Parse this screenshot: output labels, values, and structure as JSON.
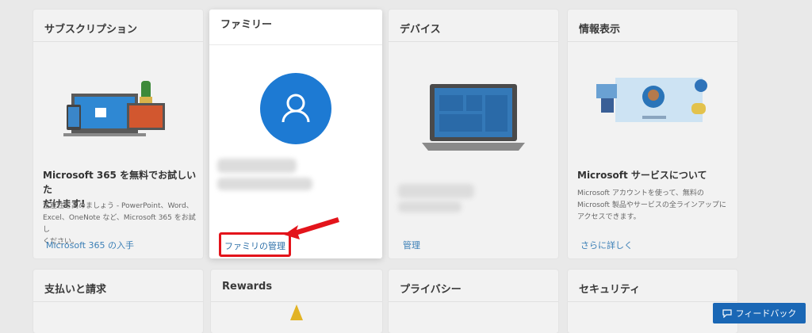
{
  "cards": {
    "subscription": {
      "title": "サブスクリプション",
      "headline_line1": "Microsoft 365 を無料でお試しいた",
      "headline_line2": "だけます!",
      "desc_line1": "生産性を高めましょう - PowerPoint、Word、",
      "desc_line2": "Excel、OneNote など、Microsoft 365 をお試し",
      "desc_line3": "ください。",
      "link": "Microsoft 365 の入手"
    },
    "family": {
      "title": "ファミリー",
      "link": "ファミリの管理"
    },
    "devices": {
      "title": "デバイス",
      "link": "管理"
    },
    "info": {
      "title": "情報表示",
      "headline": "Microsoft サービスについて",
      "desc_line1": "Microsoft アカウントを使って、無料の",
      "desc_line2": "Microsoft 製品やサービスの全ラインアップに",
      "desc_line3": "アクセスできます。",
      "link": "さらに詳しく"
    },
    "payment": {
      "title": "支払いと請求"
    },
    "rewards": {
      "title": "Rewards"
    },
    "privacy": {
      "title": "プライバシー"
    },
    "security": {
      "title": "セキュリティ"
    }
  },
  "feedback": {
    "label": "フィードバック"
  },
  "colors": {
    "accent": "#1d7ad3",
    "link": "#3b7fb6",
    "highlight_border": "#e3141b",
    "feedback_bg": "#1a67b5"
  }
}
